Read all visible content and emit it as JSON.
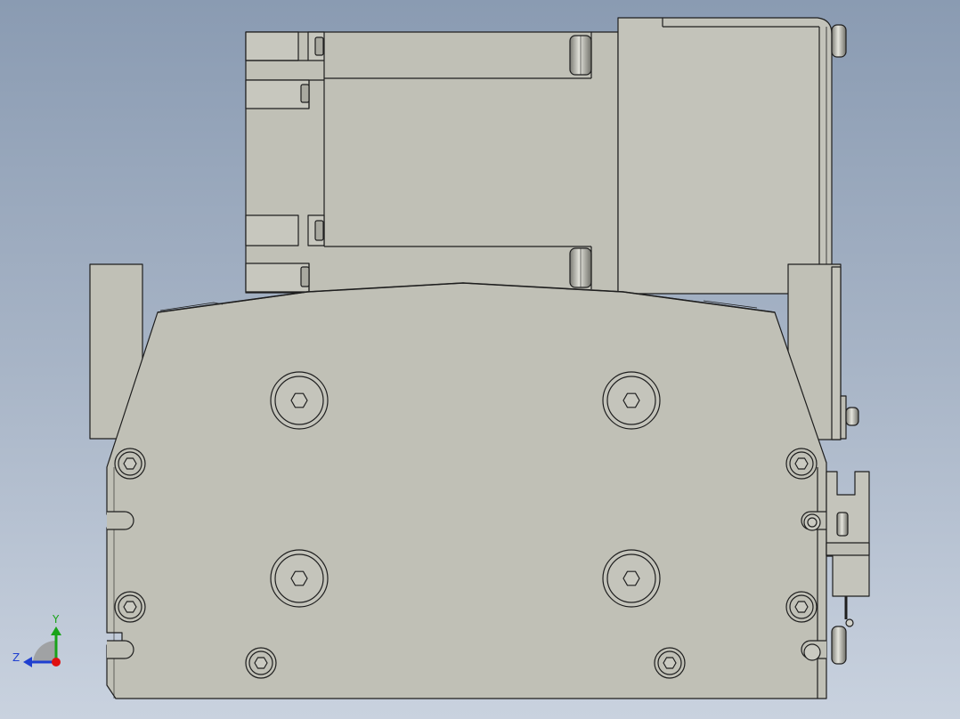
{
  "axis_triad": {
    "y_label": "Y",
    "z_label": "Z"
  },
  "colors": {
    "background_top": "#8a9bb2",
    "background_bottom": "#c9d2df",
    "part_face": "#c0c0b6",
    "part_face_light": "#cacac1",
    "edge": "#1e1e1e",
    "axis_y": "#19a319",
    "axis_z": "#1f3fd0",
    "axis_origin": "#e01010"
  }
}
